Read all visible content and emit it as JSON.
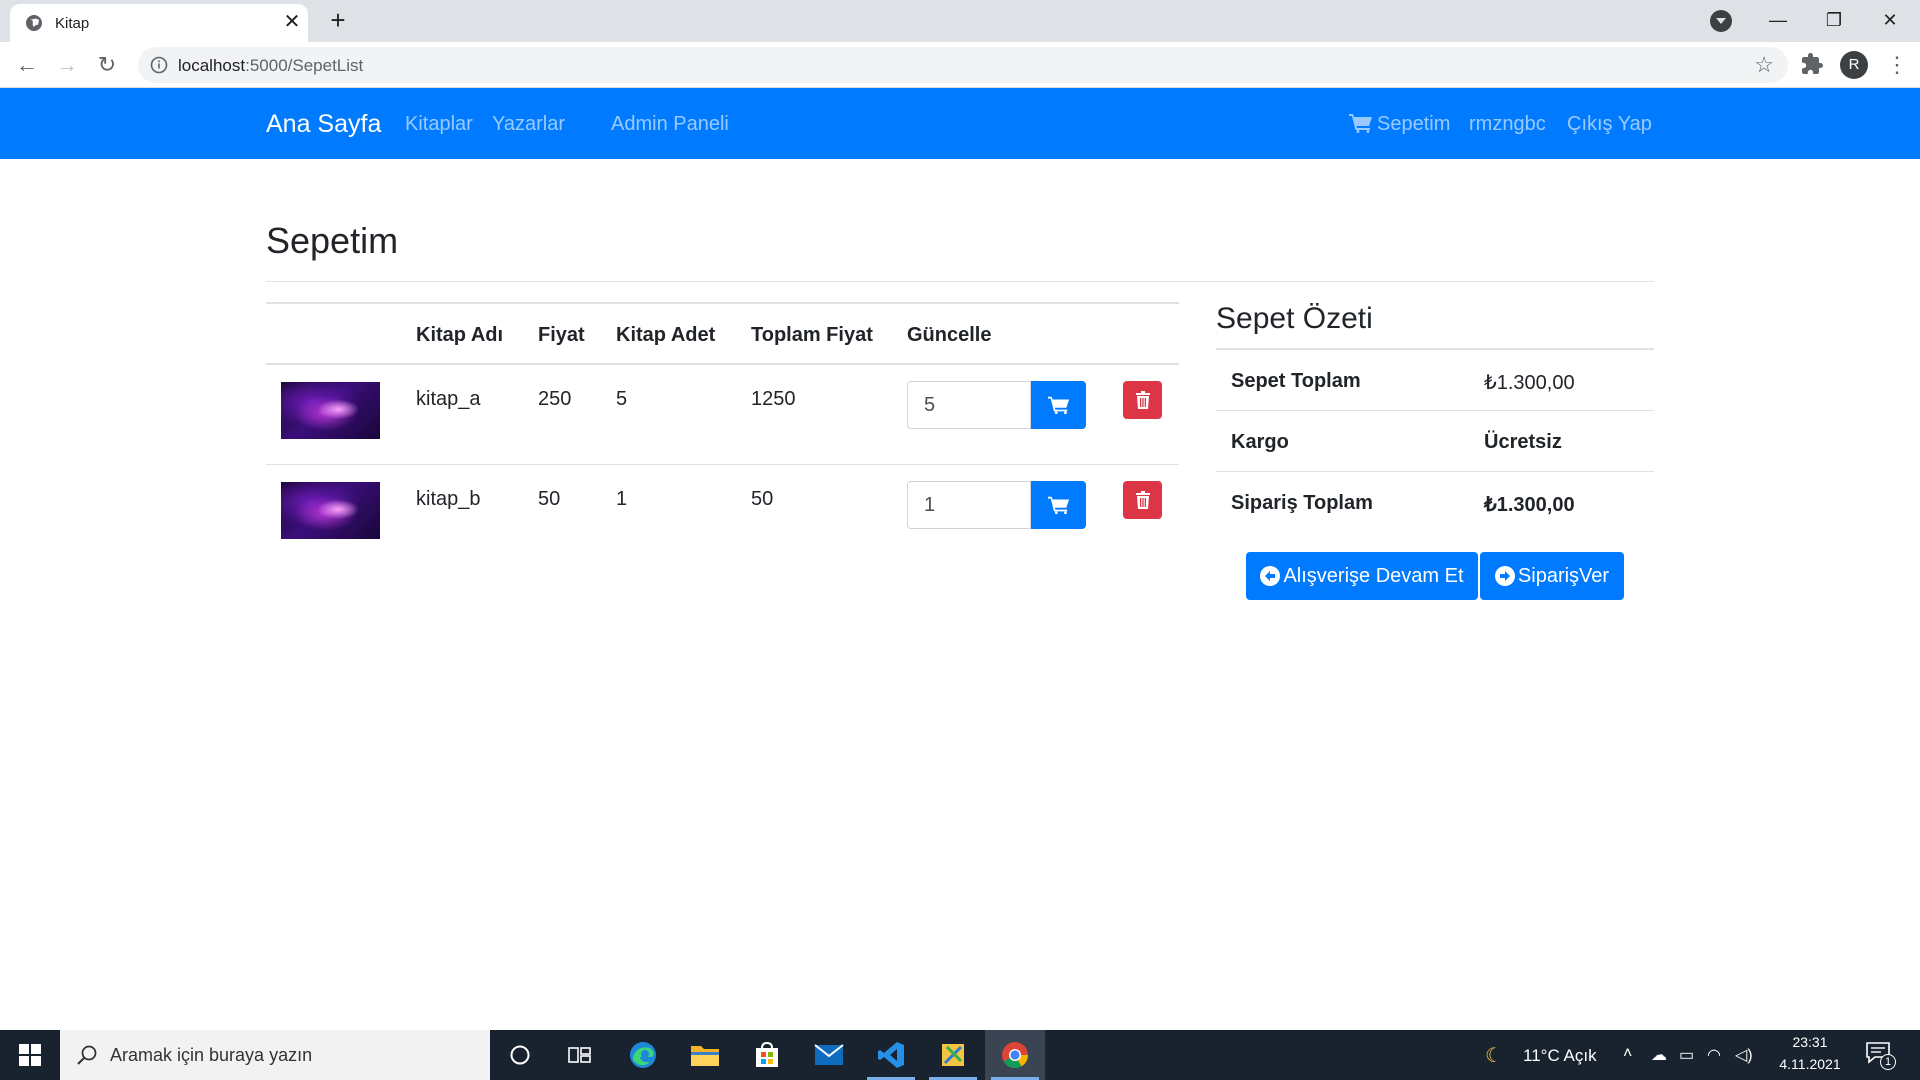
{
  "browser": {
    "tab_title": "Kitap",
    "url_host": "localhost",
    "url_rest": ":5000/SepetList",
    "profile_initial": "R"
  },
  "navbar": {
    "brand": "Ana Sayfa",
    "links": [
      "Kitaplar",
      "Yazarlar",
      "Admin Paneli"
    ],
    "cart_label": "Sepetim",
    "username": "rmzngbc",
    "logout": "Çıkış Yap"
  },
  "page_title": "Sepetim",
  "cart_table": {
    "headers": [
      "Kitap Adı",
      "Fiyat",
      "Kitap Adet",
      "Toplam Fiyat",
      "Güncelle"
    ],
    "rows": [
      {
        "name": "kitap_a",
        "price": "250",
        "qty": "5",
        "total": "1250",
        "input_value": "5"
      },
      {
        "name": "kitap_b",
        "price": "50",
        "qty": "1",
        "total": "50",
        "input_value": "1"
      }
    ]
  },
  "summary": {
    "title": "Sepet Özeti",
    "rows": [
      {
        "label": "Sepet Toplam",
        "value": "₺1.300,00"
      },
      {
        "label": "Kargo",
        "value": "Ücretsiz"
      },
      {
        "label": "Sipariş Toplam",
        "value": "₺1.300,00"
      }
    ],
    "continue_button": "Alışverişe Devam Et",
    "order_button": "SiparişVer"
  },
  "taskbar": {
    "search_placeholder": "Aramak için buraya yazın",
    "weather": "11°C  Açık",
    "time": "23:31",
    "date": "4.11.2021",
    "notification_count": "1"
  },
  "colors": {
    "primary": "#007bff",
    "danger": "#dc3545",
    "taskbar": "#19232f"
  }
}
